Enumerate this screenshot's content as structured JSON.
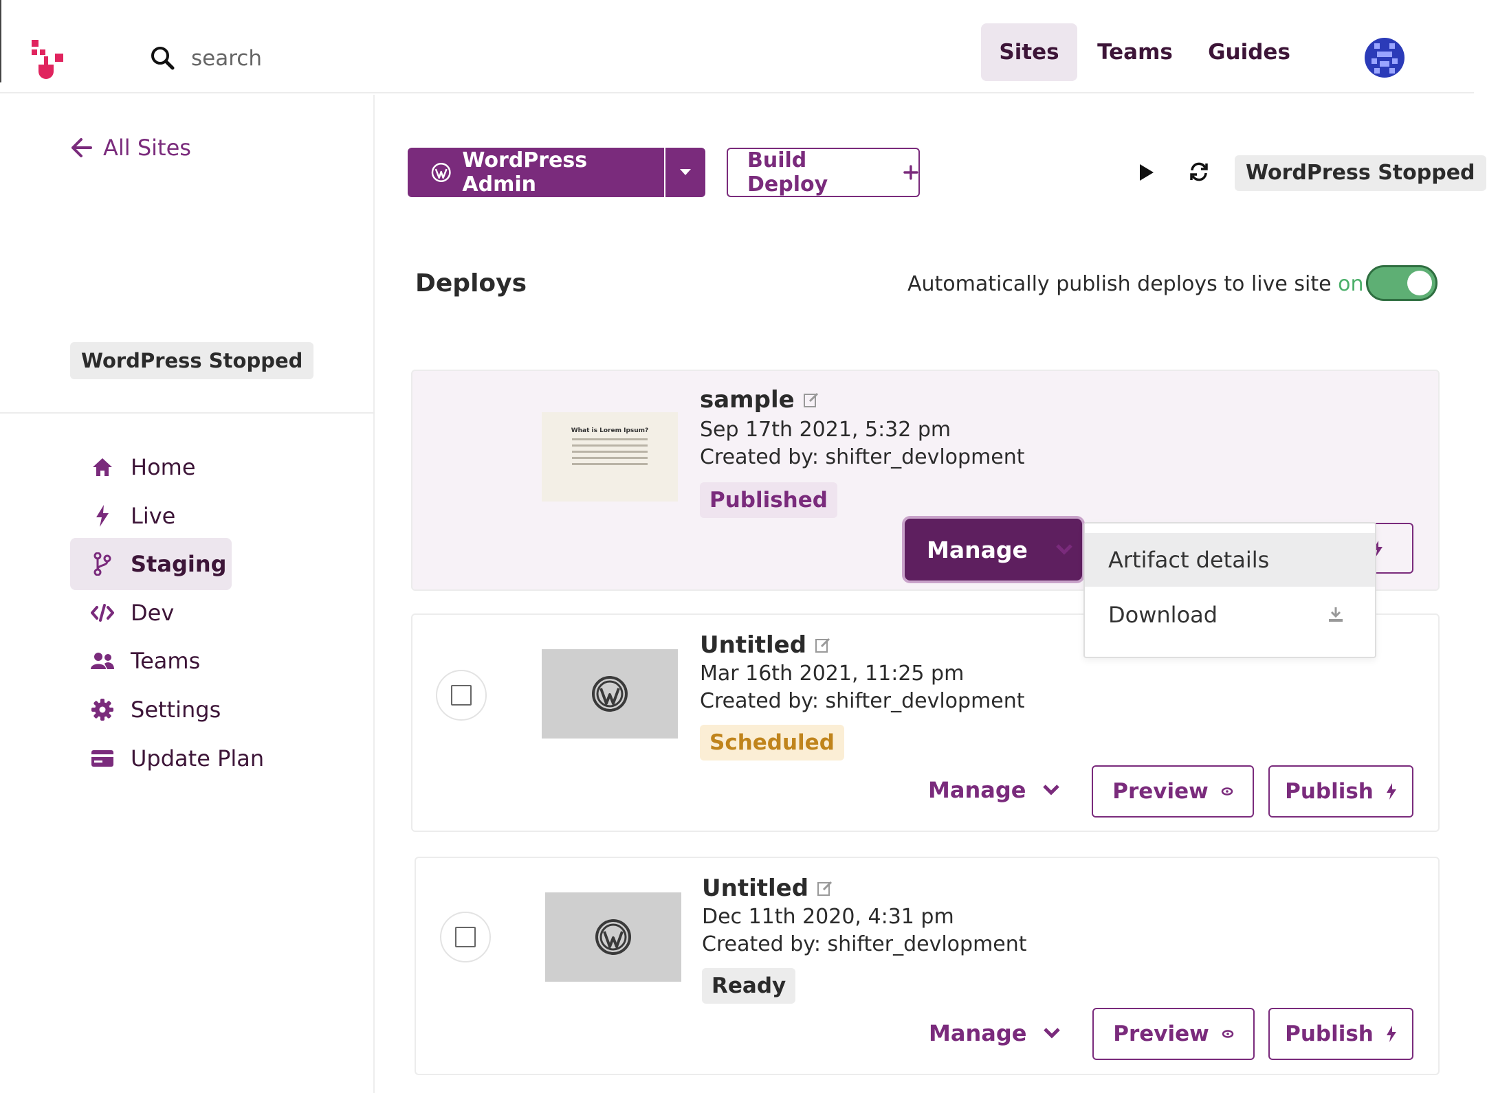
{
  "header": {
    "search_placeholder": "search",
    "nav": [
      "Sites",
      "Teams",
      "Guides"
    ],
    "active_nav": "Sites"
  },
  "sidebar": {
    "back_label": "All Sites",
    "status": "WordPress Stopped",
    "items": [
      {
        "label": "Home",
        "icon": "home-icon"
      },
      {
        "label": "Live",
        "icon": "bolt-icon"
      },
      {
        "label": "Staging",
        "icon": "branch-icon",
        "active": true
      },
      {
        "label": "Dev",
        "icon": "code-icon"
      },
      {
        "label": "Teams",
        "icon": "users-icon"
      },
      {
        "label": "Settings",
        "icon": "gear-icon"
      },
      {
        "label": "Update Plan",
        "icon": "card-icon"
      }
    ]
  },
  "toolbar": {
    "wp_admin_label": "WordPress Admin",
    "build_deploy_label": "Build Deploy",
    "status": "WordPress Stopped"
  },
  "deploys": {
    "title": "Deploys",
    "auto_publish_text": "Automatically publish deploys to live site",
    "auto_publish_state": "on",
    "auto_publish_enabled": true,
    "items": [
      {
        "name": "sample",
        "date": "Sep 17th 2021, 5:32 pm",
        "created_by": "Created by: shifter_devlopment",
        "status": "Published",
        "thumbnail_text": "What is Lorem Ipsum?"
      },
      {
        "name": "Untitled",
        "date": "Mar 16th 2021, 11:25 pm",
        "created_by": "Created by: shifter_devlopment",
        "status": "Scheduled"
      },
      {
        "name": "Untitled",
        "date": "Dec 11th 2020, 4:31 pm",
        "created_by": "Created by: shifter_devlopment",
        "status": "Ready"
      }
    ],
    "manage_label": "Manage",
    "preview_label": "Preview",
    "publish_label": "Publish"
  },
  "manage_menu": {
    "items": [
      "Artifact details",
      "Download"
    ]
  },
  "colors": {
    "brand": "#7a2b7c",
    "brand_dark": "#5e1f5f",
    "toggle_on": "#5eaf74",
    "scheduled": "#c0841c"
  }
}
